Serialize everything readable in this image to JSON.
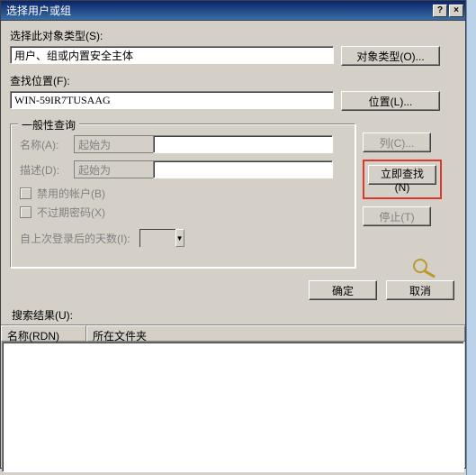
{
  "titlebar": {
    "title": "选择用户或组",
    "help": "?",
    "close": "×"
  },
  "objType": {
    "label": "选择此对象类型(S):",
    "value": "用户、组或内置安全主体",
    "button": "对象类型(O)..."
  },
  "location": {
    "label": "查找位置(F):",
    "value": "WIN-59IR7TUSAAG",
    "button": "位置(L)..."
  },
  "common": {
    "title": "一般性查询",
    "name_label": "名称(A):",
    "desc_label": "描述(D):",
    "combo_value": "起始为",
    "chk1": "禁用的帐户(B)",
    "chk2": "不过期密码(X)",
    "days_label": "自上次登录后的天数(I):"
  },
  "side": {
    "columns": "列(C)...",
    "find_now": "立即查找(N)",
    "stop": "停止(T)"
  },
  "okcancel": {
    "ok": "确定",
    "cancel": "取消"
  },
  "results": {
    "label": "搜索结果(U):",
    "col1": "名称(RDN)",
    "col2": "所在文件夹"
  },
  "magnifier": "🔍"
}
